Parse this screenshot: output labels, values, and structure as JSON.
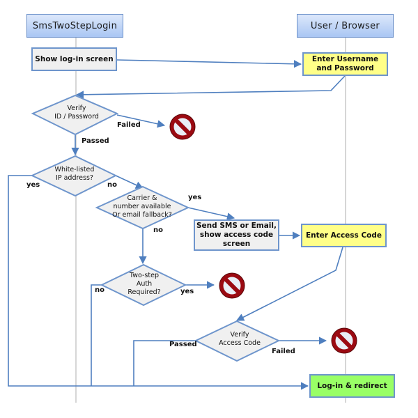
{
  "lanes": [
    {
      "title": "SmsTwoStepLogin"
    },
    {
      "title": "User / Browser"
    }
  ],
  "process_boxes": {
    "show_login": "Show log-in screen",
    "enter_credentials_line1": "Enter Username",
    "enter_credentials_line2": "and Password",
    "send_sms_line1": "Send SMS or Email,",
    "send_sms_line2": "show access code",
    "send_sms_line3": "screen",
    "enter_access_code": "Enter Access Code",
    "login_redirect": "Log-in & redirect"
  },
  "decisions": {
    "verify_id": [
      "Verify",
      "ID / Password"
    ],
    "whitelisted": [
      "White-listed",
      "IP address?"
    ],
    "carrier": [
      "Carrier &",
      "number available",
      "Or email fallback?"
    ],
    "two_step": [
      "Two-step",
      "Auth",
      "Required?"
    ],
    "verify_code": [
      "Verify",
      "Access Code"
    ]
  },
  "edge_labels": {
    "verify_id_failed": "Failed",
    "verify_id_passed": "Passed",
    "whitelisted_yes": "yes",
    "whitelisted_no": "no",
    "carrier_yes": "yes",
    "carrier_no": "no",
    "two_step_no": "no",
    "two_step_yes": "yes",
    "verify_code_passed": "Passed",
    "verify_code_failed": "Failed"
  },
  "colors": {
    "lane_header_border": "#6a8fc8",
    "edge": "#4f7fbf",
    "decision_fill": "#f0f0f0",
    "box_gray": "#f0f0f0",
    "box_yellow": "#ffff88",
    "box_green": "#99ff66",
    "stop_red": "#9b0a12"
  },
  "icons": {
    "stop": "no-entry-sign"
  }
}
